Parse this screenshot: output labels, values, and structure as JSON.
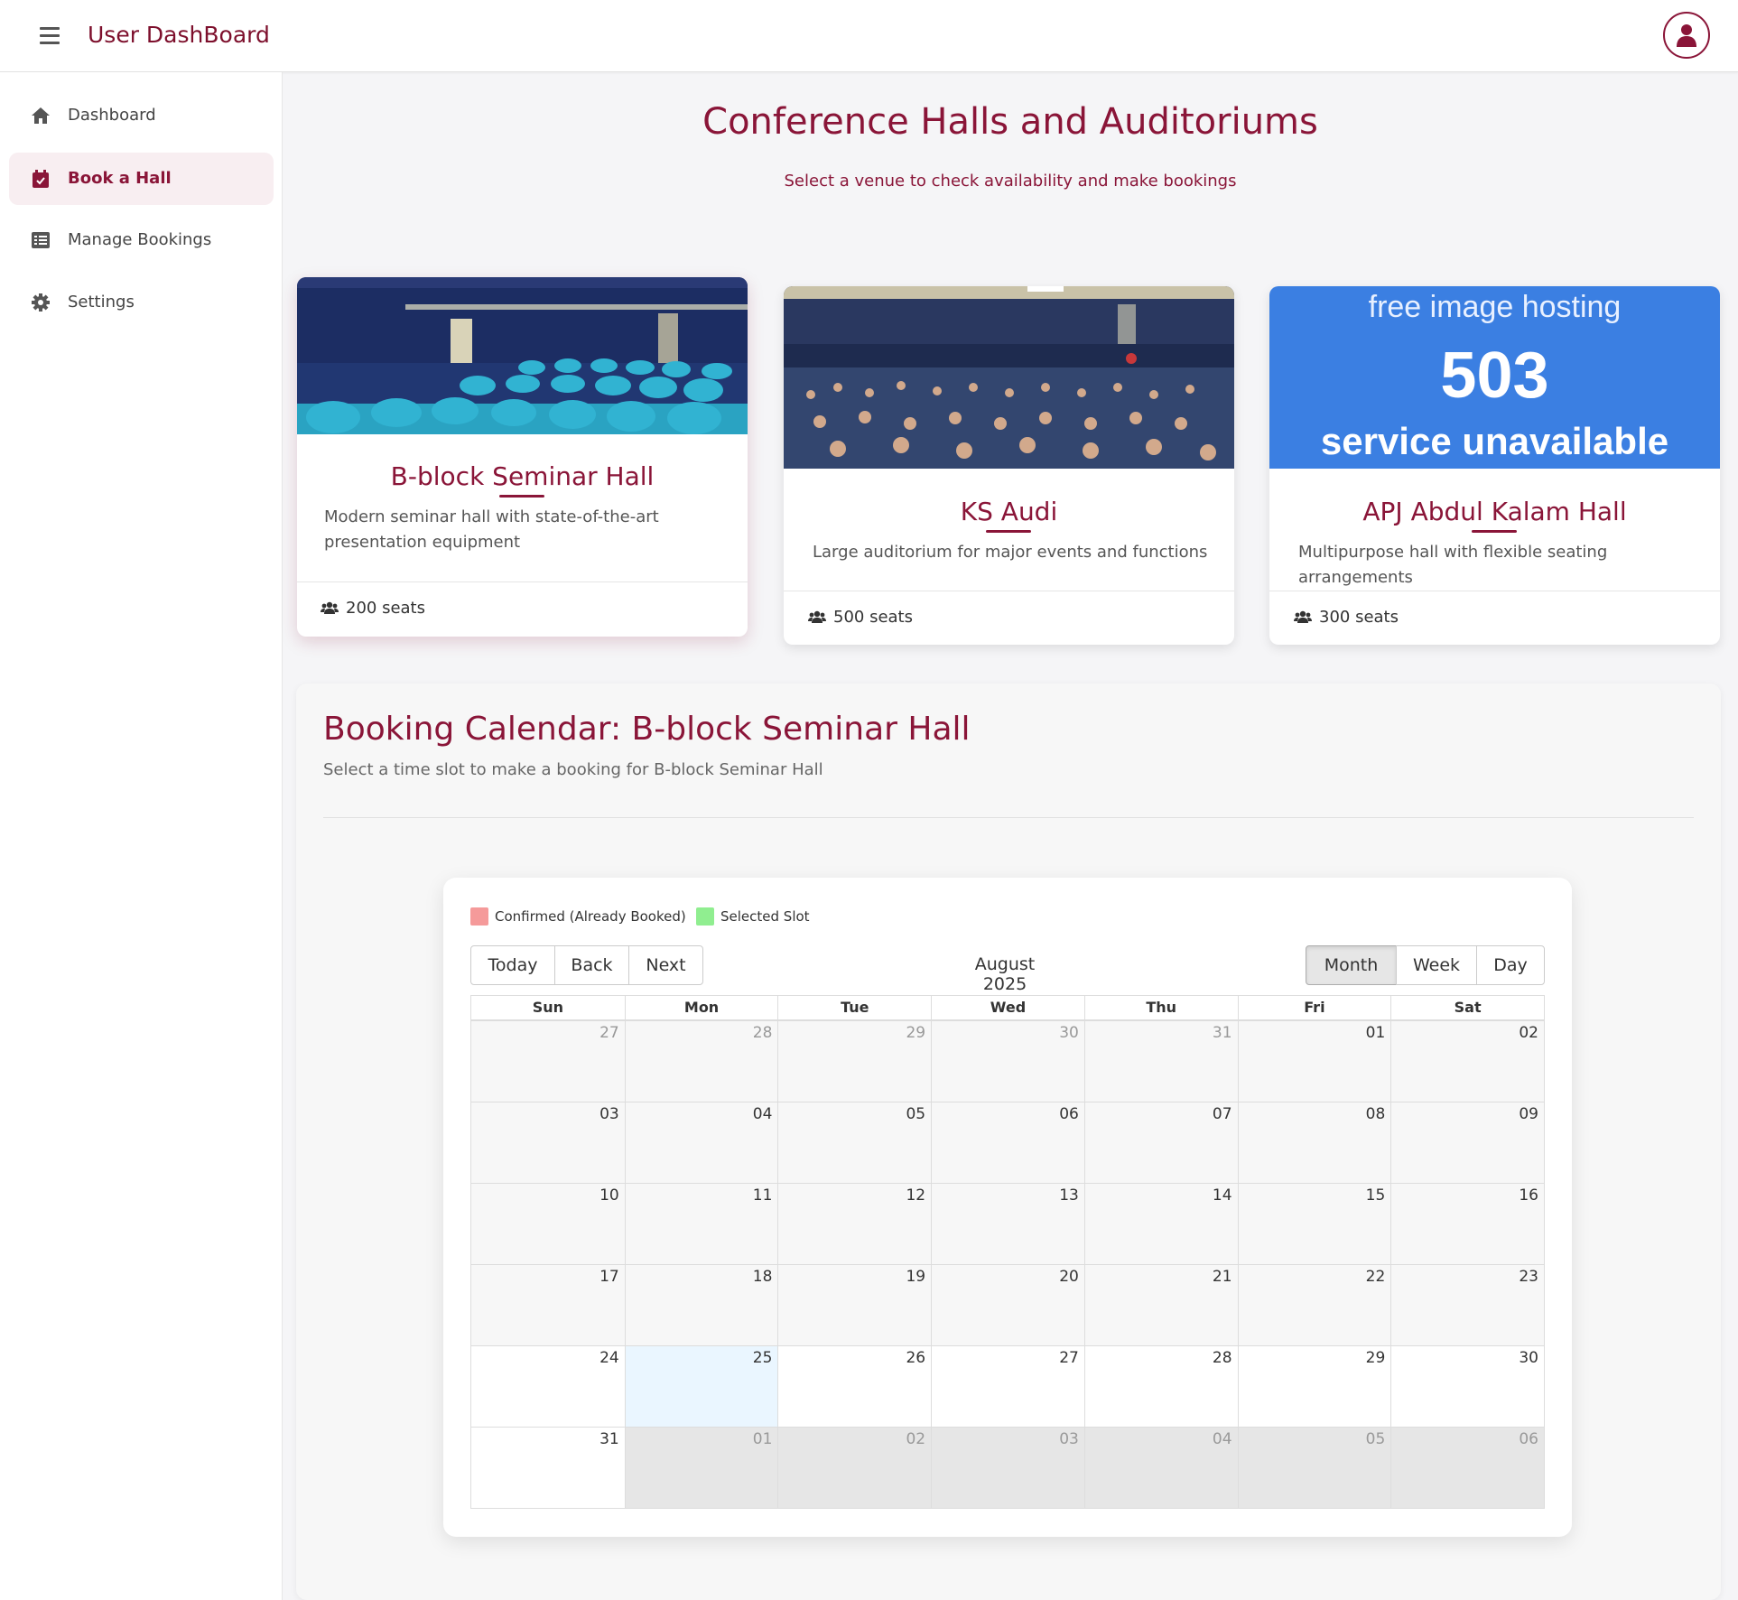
{
  "header": {
    "title": "User DashBoard",
    "menu_icon": "hamburger-icon",
    "avatar_icon": "user-icon"
  },
  "sidebar": {
    "items": [
      {
        "label": "Dashboard",
        "icon": "home-icon"
      },
      {
        "label": "Book a Hall",
        "icon": "calendar-check-icon",
        "active": true
      },
      {
        "label": "Manage Bookings",
        "icon": "list-icon"
      },
      {
        "label": "Settings",
        "icon": "gear-icon"
      }
    ]
  },
  "main": {
    "title": "Conference Halls and Auditoriums",
    "subtitle": "Select a venue to check availability and make bookings"
  },
  "halls": [
    {
      "name": "B-block Seminar Hall",
      "desc_line1": "Modern seminar hall with state-of-the-art",
      "desc_line2": "presentation equipment",
      "seats": "200 seats",
      "selected": true
    },
    {
      "name": "KS Audi",
      "desc_line1": "Large auditorium for major events and functions",
      "seats": "500 seats"
    },
    {
      "name": "APJ Abdul Kalam Hall",
      "desc_line1": "Multipurpose hall with flexible seating arrangements",
      "seats": "300 seats",
      "image_error": {
        "line1": "free image hosting",
        "line2": "503",
        "line3": "service unavailable"
      }
    }
  ],
  "booking": {
    "title": "Booking Calendar: B-block Seminar Hall",
    "subtitle": "Select a time slot to make a booking for B-block Seminar Hall",
    "legend": [
      {
        "label": "Confirmed (Already Booked)",
        "color": "#f59a9a"
      },
      {
        "label": "Selected Slot",
        "color": "#90ee90"
      }
    ],
    "toolbar": {
      "today": "Today",
      "back": "Back",
      "next": "Next",
      "month": "Month",
      "week": "Week",
      "day": "Day",
      "active_view": "Month"
    },
    "month_label": "August 2025",
    "weekdays": [
      "Sun",
      "Mon",
      "Tue",
      "Wed",
      "Thu",
      "Fri",
      "Sat"
    ],
    "weeks": [
      [
        "27",
        "28",
        "29",
        "30",
        "31",
        "01",
        "02"
      ],
      [
        "03",
        "04",
        "05",
        "06",
        "07",
        "08",
        "09"
      ],
      [
        "10",
        "11",
        "12",
        "13",
        "14",
        "15",
        "16"
      ],
      [
        "17",
        "18",
        "19",
        "20",
        "21",
        "22",
        "23"
      ],
      [
        "24",
        "25",
        "26",
        "27",
        "28",
        "29",
        "30"
      ],
      [
        "31",
        "01",
        "02",
        "03",
        "04",
        "05",
        "06"
      ]
    ],
    "today_date": "25"
  },
  "colors": {
    "brand": "#8a1538",
    "active_nav_bg": "#f8eef1",
    "today_cell": "#eaf6ff",
    "off_range": "#e6e6e6"
  }
}
